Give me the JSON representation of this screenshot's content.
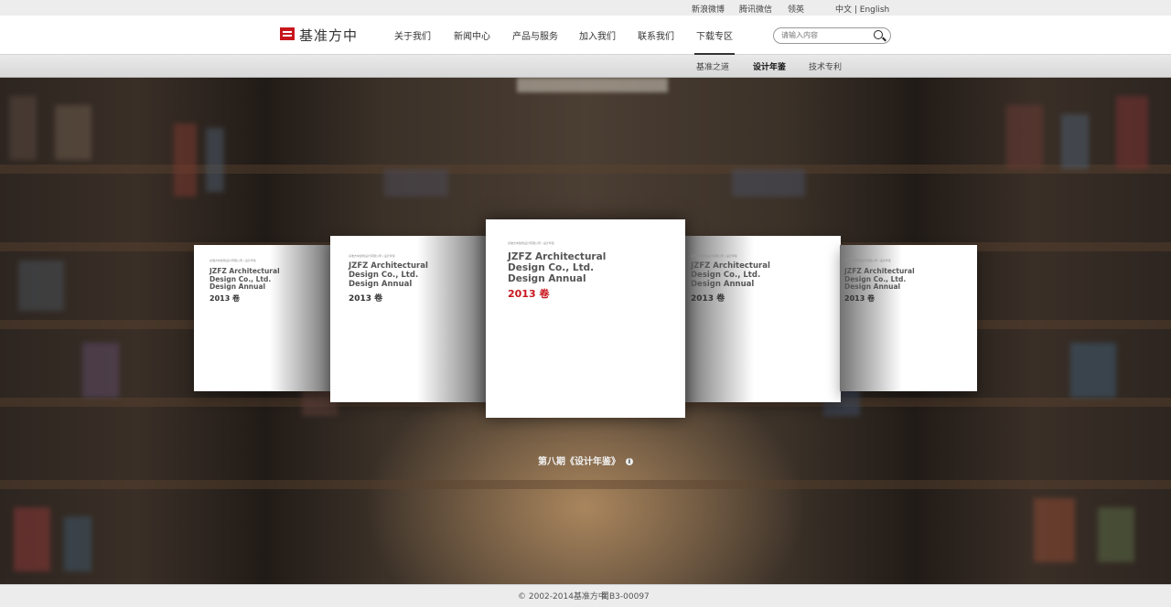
{
  "topbar": {
    "weibo": "新浪微博",
    "wechat": "腾讯微信",
    "linkedin": "领英",
    "lang": "中文 | English"
  },
  "header": {
    "logo_text": "基准方中",
    "nav": [
      "关于我们",
      "新闻中心",
      "产品与服务",
      "加入我们",
      "联系我们",
      "下载专区"
    ],
    "active_nav": "下载专区",
    "search_placeholder": "请输入内容"
  },
  "subnav": {
    "items": [
      "基准之道",
      "设计年鉴",
      "技术专利"
    ],
    "active": "设计年鉴"
  },
  "carousel": {
    "cards": [
      {
        "small": "基准方中建筑设计有限公司 / 设计年鉴",
        "title": "JZFZ Architectural\nDesign Co., Ltd.\nDesign Annual",
        "year": "2013 卷"
      },
      {
        "small": "基准方中建筑设计有限公司 / 设计年鉴",
        "title": "JZFZ Architectural\nDesign Co., Ltd.\nDesign Annual",
        "year": "2013 卷"
      },
      {
        "small": "基准方中建筑设计有限公司 / 设计年鉴",
        "title": "JZFZ Architectural\nDesign Co., Ltd.\nDesign Annual",
        "year": "2013 卷"
      },
      {
        "small": "基准方中建筑设计有限公司 / 设计年鉴",
        "title": "JZFZ Architectural\nDesign Co., Ltd.\nDesign Annual",
        "year": "2013 卷"
      },
      {
        "small": "基准方中建筑设计有限公司 / 设计年鉴",
        "title": "JZFZ Architectural\nDesign Co., Ltd.\nDesign Annual",
        "year": "2013 卷"
      }
    ],
    "caption": "第八期《设计年鉴》",
    "info_glyph": "i"
  },
  "footer": {
    "copyright": "© 2002-2014基准方中",
    "icp": "蜀B3-00097"
  },
  "colors": {
    "brand_red": "#c8161d"
  }
}
